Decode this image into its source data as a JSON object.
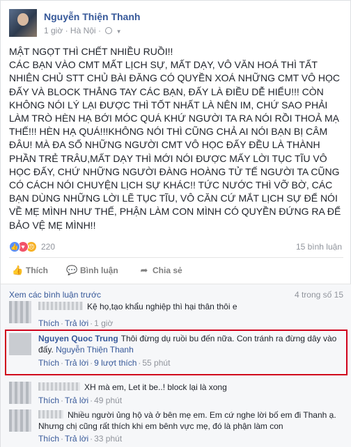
{
  "post": {
    "author": "Nguyễn Thiện Thanh",
    "time": "1 giờ",
    "location": "Hà Nội",
    "paragraphs": [
      "MẬT NGỌT THÌ CHẾT NHIỀU RUỒI!!",
      "CÁC BẠN VÀO CMT MẤT LỊCH SỰ, MẤT DẠY, VÔ VĂN HOÁ THÌ TẤT NHIÊN CHỦ STT CHỦ BÀI ĐĂNG CÓ QUYỀN XOÁ NHỮNG CMT VÔ HỌC ĐẤY VÀ BLOCK THẲNG TAY CÁC BẠN, ĐẤY LÀ ĐIỀU DỄ HIỂU!!! CÒN KHÔNG NÓI LÝ LẠI ĐƯỢC THÌ TỐT NHẤT LÀ NÊN IM, CHỨ SAO PHẢI LÀM TRÒ HÈN HẠ BỚI MÓC QUÁ KHỨ NGƯỜI TA RA NÓI RỒI THOẢ MẠ THẾ!!! HÈN HẠ QUÁ!!!KHÔNG NÓI THÌ CŨNG CHẢ AI NÓI BẠN BỊ CÂM ĐÂU! MÀ ĐA SỐ NHỮNG NGƯỜI CMT VÔ HỌC ĐẤY ĐỀU LÀ THÀNH PHẦN TRẺ TRÂU,MẤT DẠY THÌ MỚI NÓI ĐƯỢC MẤY LỜI TỤC TĨU VÔ HỌC ĐẤY, CHỨ NHỮNG NGƯỜI ĐÀNG HOÀNG TỬ TẾ NGƯỜI TA CŨNG CÓ CÁCH NÓI CHUYỆN LỊCH SỰ KHÁC!! TỨC NƯỚC THÌ VỠ BỜ, CÁC BẠN DÙNG NHỮNG LỜI LẼ TỤC TĨU, VÔ CĂN CỨ MẮT LỊCH SỰ ĐỂ NÓI VỀ MẸ MÌNH NHƯ THẾ, PHẬN LÀM CON MÌNH CÓ QUYỀN ĐỨNG RA ĐỂ BẢO VỆ MẸ MÌNH!!"
    ]
  },
  "reactions": {
    "count": "220",
    "comments": "15 bình luận"
  },
  "actions": {
    "like": "Thích",
    "comment": "Bình luận",
    "share": "Chia sẻ"
  },
  "comments_header": {
    "prev": "Xem các bình luận trước",
    "count": "4 trong số 15"
  },
  "comments": [
    {
      "author": "",
      "text": "Kệ họ,tạo khẩu nghiệp thì hại thân thôi e",
      "like": "Thích",
      "reply": "Trả lời",
      "likes": "",
      "time": "1 giờ"
    },
    {
      "author": "Nguyen Quoc Trung",
      "text": "Thôi đừng dụ ruồi bu đến nữa. Con tránh ra đừng dây vào đấy.",
      "tag": "Nguyễn Thiện Thanh",
      "like": "Thích",
      "reply": "Trả lời",
      "likes": "9 lượt thích",
      "time": "55 phút"
    },
    {
      "author": "",
      "text": "XH mà em, Let it be..! block lại là xong",
      "like": "Thích",
      "reply": "Trả lời",
      "likes": "",
      "time": "49 phút"
    },
    {
      "author": "",
      "text": "Nhiều người ủng hộ và ở bên mẹ em. Em cứ nghe lời bố em đi Thanh ạ. Nhưng chị cũng rất thích khi em bênh vực mẹ, đó là phận làm con",
      "like": "Thích",
      "reply": "Trả lời",
      "likes": "",
      "time": "33 phút"
    }
  ]
}
